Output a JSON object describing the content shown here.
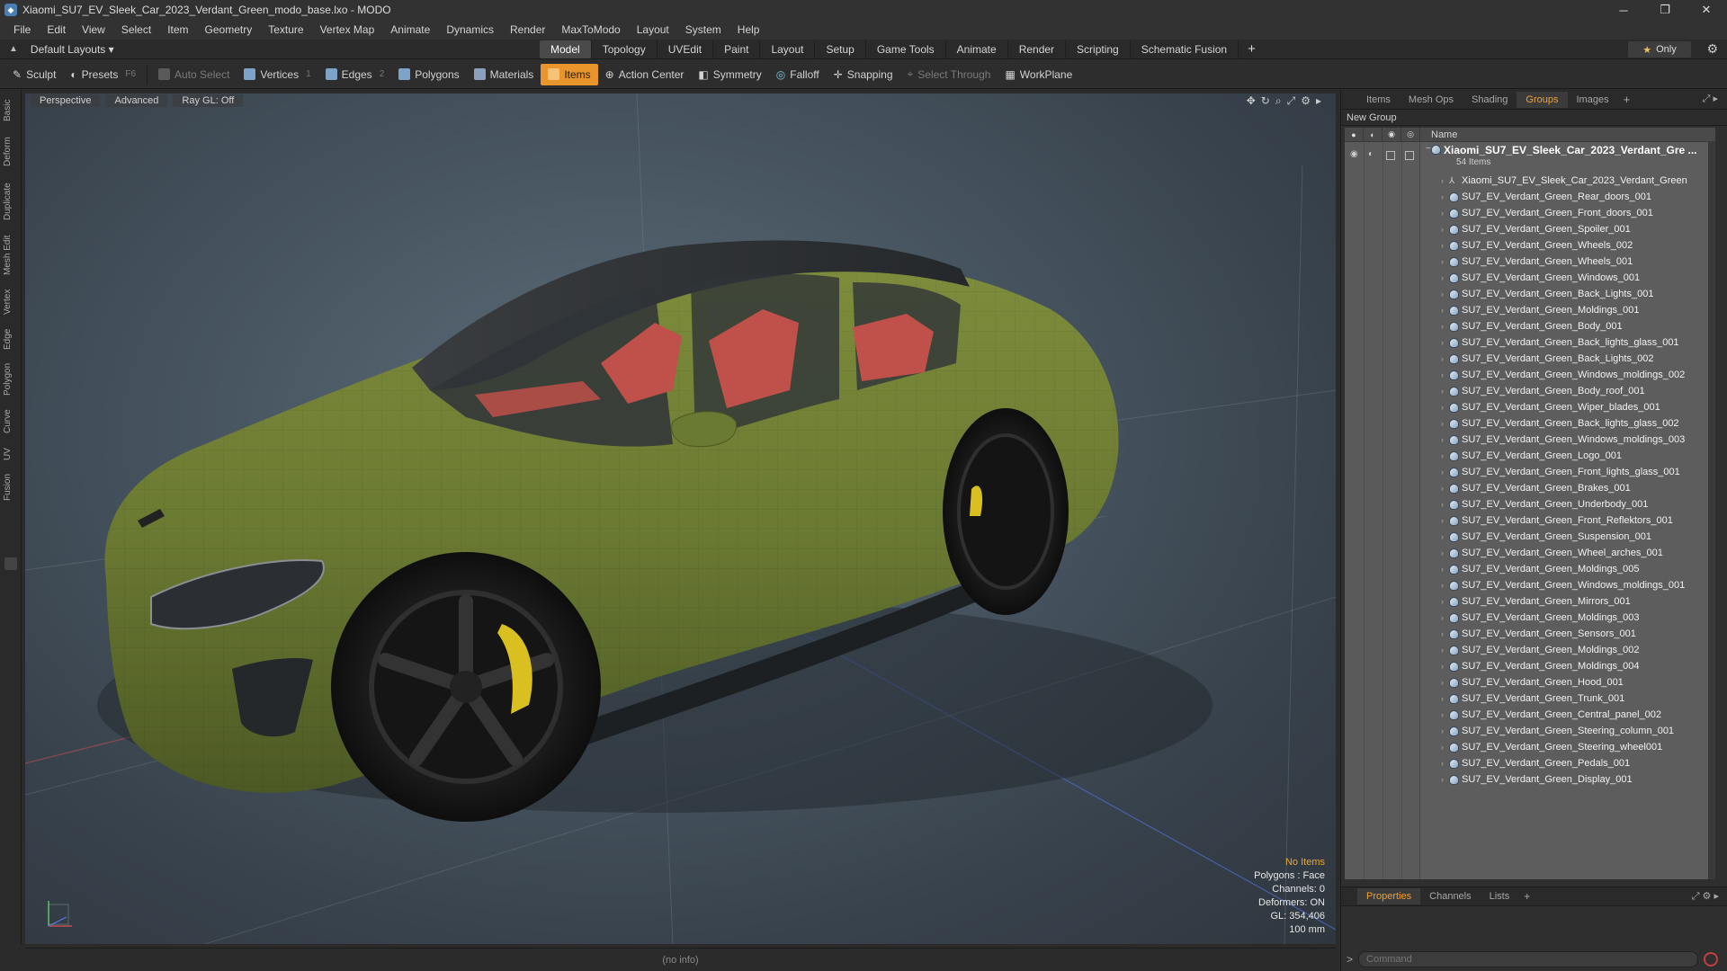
{
  "window": {
    "title": "Xiaomi_SU7_EV_Sleek_Car_2023_Verdant_Green_modo_base.lxo - MODO",
    "minimize": "─",
    "maximize": "❐",
    "close": "✕"
  },
  "menu": [
    "File",
    "Edit",
    "View",
    "Select",
    "Item",
    "Geometry",
    "Texture",
    "Vertex Map",
    "Animate",
    "Dynamics",
    "Render",
    "MaxToModo",
    "Layout",
    "System",
    "Help"
  ],
  "layout": {
    "selector": "Default Layouts ▾",
    "tabs": [
      "Model",
      "Topology",
      "UVEdit",
      "Paint",
      "Layout",
      "Setup",
      "Game Tools",
      "Animate",
      "Render",
      "Scripting",
      "Schematic Fusion"
    ],
    "active_tab": "Model",
    "plus": "+",
    "only_label": "Only",
    "only_star": "★"
  },
  "toolbar": {
    "sculpt": "Sculpt",
    "presets": "Presets",
    "presets_key": "F6",
    "auto_select": "Auto Select",
    "vertices": "Vertices",
    "vertices_key": "1",
    "edges": "Edges",
    "edges_key": "2",
    "polygons": "Polygons",
    "materials": "Materials",
    "items": "Items",
    "action_center": "Action Center",
    "symmetry": "Symmetry",
    "falloff": "Falloff",
    "snapping": "Snapping",
    "select_through": "Select Through",
    "workplane": "WorkPlane"
  },
  "left_tabs": [
    "Basic",
    "Deform",
    "Duplicate",
    "Mesh Edit",
    "Vertex",
    "Edge",
    "Polygon",
    "Curve",
    "UV",
    "Fusion"
  ],
  "viewport": {
    "view": "Perspective",
    "shading": "Advanced",
    "raygl": "Ray GL: Off",
    "info": {
      "no_items": "No Items",
      "polygons": "Polygons : Face",
      "channels": "Channels: 0",
      "deformers": "Deformers: ON",
      "gl": "GL: 354,406",
      "scale": "100 mm"
    }
  },
  "status": "(no info)",
  "right_panel": {
    "tabs": [
      "Items",
      "Mesh Ops",
      "Shading",
      "Groups",
      "Images"
    ],
    "active_tab": "Groups",
    "new_group": "New Group",
    "column_name": "Name",
    "root": {
      "name": "Xiaomi_SU7_EV_Sleek_Car_2023_Verdant_Gre ...",
      "count": "54 Items"
    },
    "items": [
      "Xiaomi_SU7_EV_Sleek_Car_2023_Verdant_Green",
      "SU7_EV_Verdant_Green_Rear_doors_001",
      "SU7_EV_Verdant_Green_Front_doors_001",
      "SU7_EV_Verdant_Green_Spoiler_001",
      "SU7_EV_Verdant_Green_Wheels_002",
      "SU7_EV_Verdant_Green_Wheels_001",
      "SU7_EV_Verdant_Green_Windows_001",
      "SU7_EV_Verdant_Green_Back_Lights_001",
      "SU7_EV_Verdant_Green_Moldings_001",
      "SU7_EV_Verdant_Green_Body_001",
      "SU7_EV_Verdant_Green_Back_lights_glass_001",
      "SU7_EV_Verdant_Green_Back_Lights_002",
      "SU7_EV_Verdant_Green_Windows_moldings_002",
      "SU7_EV_Verdant_Green_Body_roof_001",
      "SU7_EV_Verdant_Green_Wiper_blades_001",
      "SU7_EV_Verdant_Green_Back_lights_glass_002",
      "SU7_EV_Verdant_Green_Windows_moldings_003",
      "SU7_EV_Verdant_Green_Logo_001",
      "SU7_EV_Verdant_Green_Front_lights_glass_001",
      "SU7_EV_Verdant_Green_Brakes_001",
      "SU7_EV_Verdant_Green_Underbody_001",
      "SU7_EV_Verdant_Green_Front_Reflektors_001",
      "SU7_EV_Verdant_Green_Suspension_001",
      "SU7_EV_Verdant_Green_Wheel_arches_001",
      "SU7_EV_Verdant_Green_Moldings_005",
      "SU7_EV_Verdant_Green_Windows_moldings_001",
      "SU7_EV_Verdant_Green_Mirrors_001",
      "SU7_EV_Verdant_Green_Moldings_003",
      "SU7_EV_Verdant_Green_Sensors_001",
      "SU7_EV_Verdant_Green_Moldings_002",
      "SU7_EV_Verdant_Green_Moldings_004",
      "SU7_EV_Verdant_Green_Hood_001",
      "SU7_EV_Verdant_Green_Trunk_001",
      "SU7_EV_Verdant_Green_Central_panel_002",
      "SU7_EV_Verdant_Green_Steering_column_001",
      "SU7_EV_Verdant_Green_Steering_wheel001",
      "SU7_EV_Verdant_Green_Pedals_001",
      "SU7_EV_Verdant_Green_Display_001"
    ],
    "bottom_tabs": [
      "Properties",
      "Channels",
      "Lists"
    ],
    "bottom_active": "Properties",
    "command_placeholder": "Command",
    "command_prompt": ">"
  },
  "colors": {
    "accent": "#e8952b",
    "car_body": "#6b7a32",
    "interior": "#c0504a"
  }
}
